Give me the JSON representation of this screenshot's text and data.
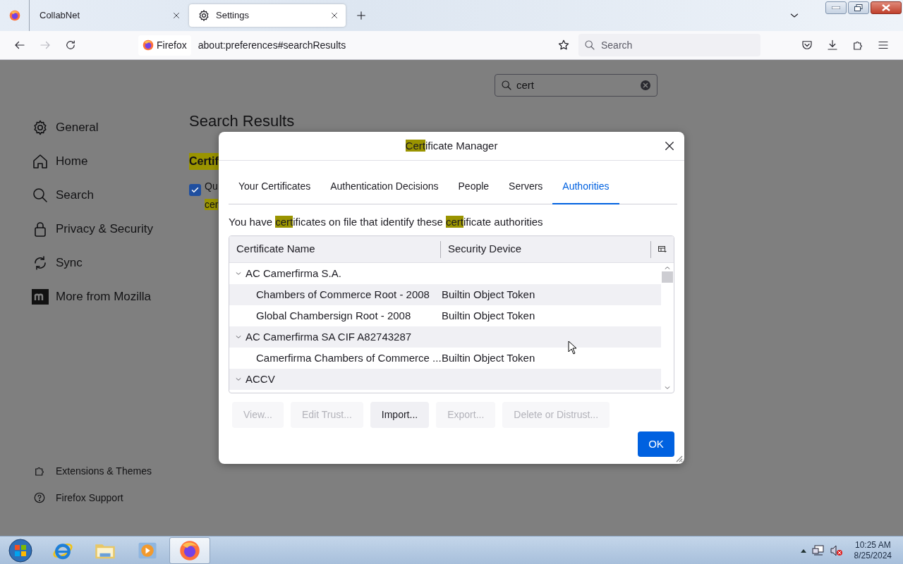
{
  "browser": {
    "tabs": [
      {
        "kind": "pinned",
        "selected": false
      },
      {
        "kind": "plain",
        "label": "CollabNet",
        "selected": false
      },
      {
        "kind": "with_icon",
        "label": "Settings",
        "selected": true
      }
    ],
    "identity_label": "Firefox",
    "url": "about:preferences#searchResults",
    "search": {
      "placeholder": "Search"
    }
  },
  "settings": {
    "search_field": {
      "value": "cert"
    },
    "sidebar": [
      {
        "label": "General"
      },
      {
        "label": "Home"
      },
      {
        "label": "Search"
      },
      {
        "label": "Privacy & Security"
      },
      {
        "label": "Sync"
      },
      {
        "label": "More from Mozilla"
      }
    ],
    "footer_links": [
      {
        "label": "Extensions & Themes"
      },
      {
        "label": "Firefox Support"
      }
    ],
    "heading": "Search Results",
    "group_title": {
      "text": "Certif",
      "highlighted": true
    },
    "checkbox": {
      "checked": true,
      "line_1": {
        "text": "Qu",
        "highlighted": false
      },
      "line_2": {
        "text": "cer",
        "highlighted": true
      }
    }
  },
  "dialog": {
    "title": [
      {
        "text": "Cert",
        "highlighted": true
      },
      {
        "text": "ificate Manager",
        "highlighted": false
      }
    ],
    "tabs": [
      {
        "label": "Your Certificates",
        "selected": false
      },
      {
        "label": "Authentication Decisions",
        "selected": false
      },
      {
        "label": "People",
        "selected": false
      },
      {
        "label": "Servers",
        "selected": false
      },
      {
        "label": "Authorities",
        "selected": true
      }
    ],
    "description": [
      {
        "text": "You have ",
        "highlighted": false
      },
      {
        "text": "cert",
        "highlighted": true
      },
      {
        "text": "ificates on file that identify these ",
        "highlighted": false
      },
      {
        "text": "cert",
        "highlighted": true
      },
      {
        "text": "ificate authorities",
        "highlighted": false
      }
    ],
    "columns": [
      "Certificate Name",
      "Security Device"
    ],
    "rows": [
      {
        "kind": "group",
        "name": "AC Camerfirma S.A.",
        "expanded": true,
        "children": [
          {
            "kind": "item",
            "name": "Chambers of Commerce Root - 2008",
            "device": "Builtin Object Token"
          },
          {
            "kind": "item",
            "name": "Global Chambersign Root - 2008",
            "device": "Builtin Object Token"
          }
        ]
      },
      {
        "kind": "group",
        "name": "AC Camerfirma SA CIF A82743287",
        "expanded": true,
        "children": [
          {
            "kind": "item",
            "name": "Camerfirma Chambers of Commerce ...",
            "device": "Builtin Object Token"
          }
        ]
      },
      {
        "kind": "group",
        "name": "ACCV",
        "expanded": true
      }
    ],
    "buttons": [
      {
        "label": "View...",
        "disabled": true
      },
      {
        "label": "Edit Trust...",
        "disabled": true
      },
      {
        "label": "Import...",
        "disabled": false
      },
      {
        "label": "Export...",
        "disabled": true
      },
      {
        "label": "Delete or Distrust...",
        "disabled": true
      }
    ],
    "ok": "OK"
  },
  "taskbar": {
    "apps": [
      {
        "selected": false
      },
      {
        "selected": false
      },
      {
        "selected": false
      },
      {
        "selected": true
      }
    ],
    "clock": {
      "time": "10:25 AM",
      "date": "8/25/2024"
    }
  }
}
